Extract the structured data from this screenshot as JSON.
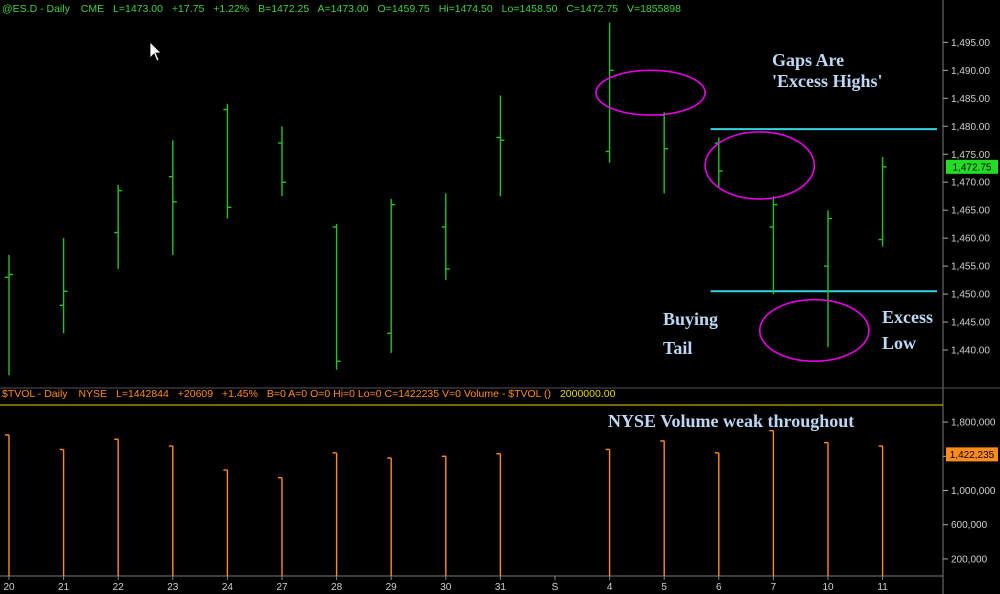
{
  "header_top": {
    "symbol": "@ES.D - Daily",
    "exchange": "CME",
    "last": "L=1473.00",
    "change": "+17.75",
    "pct": "+1.22%",
    "bid": "B=1472.25",
    "ask": "A=1473.00",
    "open": "O=1459.75",
    "high": "Hi=1474.50",
    "low": "Lo=1458.50",
    "close": "C=1472.75",
    "volume": "V=1855898"
  },
  "header_bottom": {
    "symbol": "$TVOL - Daily",
    "exchange": "NYSE",
    "last": "L=1442844",
    "change": "+20609",
    "pct": "+1.45%",
    "rest": "B=0  A=0  O=0  Hi=0  Lo=0  C=1422235  V=0  Volume - $TVOL  ()",
    "level": "2000000.00"
  },
  "annotations": {
    "gaps_line1": "Gaps Are",
    "gaps_line2": "'Excess Highs'",
    "buying_line1": "Buying",
    "buying_line2": "Tail",
    "excess_line1": "Excess",
    "excess_line2": "Low",
    "volume_note": "NYSE Volume weak throughout"
  },
  "colors": {
    "price": "#22c322",
    "volume": "#ff8c1a",
    "ellipse": "#e600e6",
    "hline": "#33d6e0",
    "level": "#e6d600",
    "header_green": "#3fd23f",
    "header_orange": "#ff8c1a",
    "header_yellow": "#e6d600",
    "last_price_bg": "#22dd22",
    "last_volume_bg": "#ff8c1a"
  },
  "chart_data": [
    {
      "type": "ohlc",
      "symbol": "@ES.D",
      "categories": [
        "20",
        "21",
        "22",
        "23",
        "24",
        "27",
        "28",
        "29",
        "30",
        "31",
        "S",
        "4",
        "5",
        "6",
        "7",
        "10",
        "11"
      ],
      "bars": [
        {
          "x": "20",
          "open": 1453.0,
          "high": 1457.0,
          "low": 1435.5,
          "close": 1453.5
        },
        {
          "x": "21",
          "open": 1448.0,
          "high": 1460.0,
          "low": 1443.0,
          "close": 1450.5
        },
        {
          "x": "22",
          "open": 1461.0,
          "high": 1469.5,
          "low": 1454.5,
          "close": 1468.5
        },
        {
          "x": "23",
          "open": 1471.0,
          "high": 1477.5,
          "low": 1457.0,
          "close": 1466.5
        },
        {
          "x": "24",
          "open": 1483.0,
          "high": 1484.0,
          "low": 1463.5,
          "close": 1465.5
        },
        {
          "x": "27",
          "open": 1477.0,
          "high": 1480.0,
          "low": 1467.5,
          "close": 1470.0
        },
        {
          "x": "28",
          "open": 1462.0,
          "high": 1462.5,
          "low": 1436.5,
          "close": 1438.0
        },
        {
          "x": "29",
          "open": 1443.0,
          "high": 1467.0,
          "low": 1439.5,
          "close": 1466.0
        },
        {
          "x": "30",
          "open": 1462.0,
          "high": 1468.0,
          "low": 1452.5,
          "close": 1454.5
        },
        {
          "x": "31",
          "open": 1478.0,
          "high": 1485.5,
          "low": 1467.5,
          "close": 1477.5
        },
        {
          "x": "4",
          "open": 1475.5,
          "high": 1498.5,
          "low": 1473.5,
          "close": 1490.0
        },
        {
          "x": "5",
          "open": 1482.0,
          "high": 1482.5,
          "low": 1468.0,
          "close": 1476.0
        },
        {
          "x": "6",
          "open": 1477.0,
          "high": 1478.0,
          "low": 1469.0,
          "close": 1472.0
        },
        {
          "x": "7",
          "open": 1462.0,
          "high": 1467.5,
          "low": 1450.0,
          "close": 1466.0
        },
        {
          "x": "10",
          "open": 1455.0,
          "high": 1465.0,
          "low": 1440.5,
          "close": 1463.5
        },
        {
          "x": "11",
          "open": 1459.75,
          "high": 1474.5,
          "low": 1458.5,
          "close": 1472.75
        }
      ],
      "ylim": [
        1435,
        1499
      ],
      "yticks": [
        1440,
        1445,
        1450,
        1455,
        1460,
        1465,
        1470,
        1475,
        1480,
        1485,
        1490,
        1495
      ],
      "ytick_labels": [
        "1,440.00",
        "1,445.00",
        "1,450.00",
        "1,455.00",
        "1,460.00",
        "1,465.00",
        "1,470.00",
        "1,475.00",
        "1,480.00",
        "1,485.00",
        "1,490.00",
        "1,495.00"
      ],
      "last_value": 1472.75,
      "last_label": "1,472.75",
      "hlines": [
        1479.5,
        1450.5
      ],
      "ellipses": [
        {
          "cx": "4.5",
          "cy": 1486,
          "rx_bars": 1.0,
          "ry_value": 4.0
        },
        {
          "cx": "6.5",
          "cy": 1473,
          "rx_bars": 1.0,
          "ry_value": 6.0
        },
        {
          "cx": "7.5",
          "cy": 1443.5,
          "rx_bars": 1.0,
          "ry_value": 5.5
        }
      ],
      "grid": false
    },
    {
      "type": "bar",
      "symbol": "$TVOL",
      "categories": [
        "20",
        "21",
        "22",
        "23",
        "24",
        "27",
        "28",
        "29",
        "30",
        "31",
        "S",
        "4",
        "5",
        "6",
        "7",
        "10",
        "11"
      ],
      "values": [
        1650000,
        1480000,
        1600000,
        1520000,
        1240000,
        1150000,
        1440000,
        1380000,
        1400000,
        1430000,
        null,
        1480000,
        1580000,
        1440000,
        1700000,
        1560000,
        1520000
      ],
      "ylim": [
        0,
        2000000
      ],
      "yticks": [
        200000,
        600000,
        1000000,
        1400000,
        1800000
      ],
      "ytick_labels": [
        "200,000",
        "600,000",
        "1,000,000",
        "1,400,000",
        "1,800,000"
      ],
      "last_value": 1422235,
      "last_label": "1,422,235",
      "level_line": 2000000
    }
  ]
}
